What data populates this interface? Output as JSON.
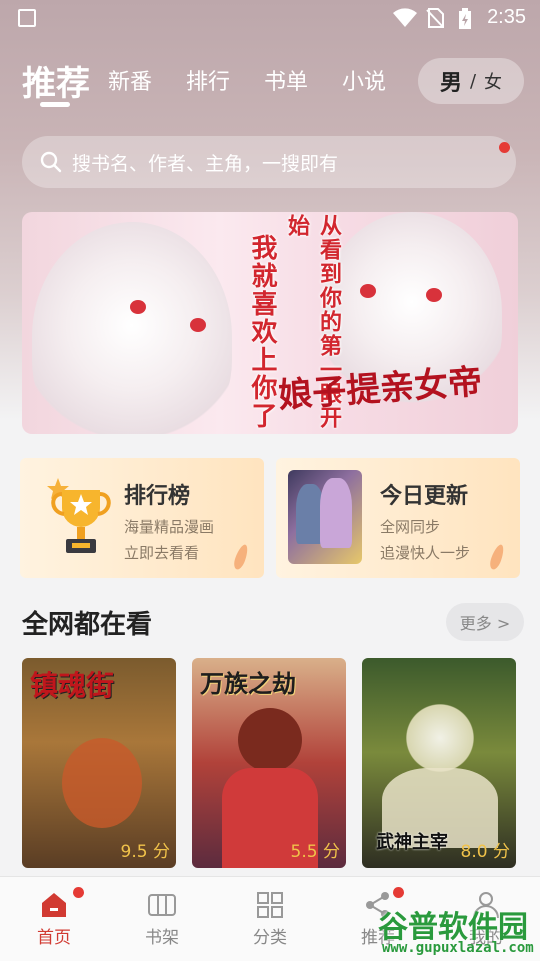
{
  "status_bar": {
    "time": "2:35",
    "icons": [
      "photo-icon",
      "wifi-icon",
      "no-sim-icon",
      "battery-charging-icon"
    ]
  },
  "top_tabs": [
    {
      "label": "推荐",
      "active": true
    },
    {
      "label": "新番",
      "active": false
    },
    {
      "label": "排行",
      "active": false
    },
    {
      "label": "书单",
      "active": false
    },
    {
      "label": "小说",
      "active": false
    }
  ],
  "gender_toggle": {
    "male": "男",
    "sep": "/",
    "female": "女"
  },
  "search": {
    "placeholder": "搜书名、作者、主角，一搜即有"
  },
  "banner": {
    "line1": "我就喜欢上你了",
    "line2": "从看到你的第一眼开始",
    "art_title": "娘子提亲女帝"
  },
  "cards": [
    {
      "title": "排行榜",
      "line1": "海量精品漫画",
      "line2": "立即去看看",
      "icon": "trophy-icon"
    },
    {
      "title": "今日更新",
      "line1": "全网同步",
      "line2": "追漫快人一步",
      "icon": "comic-thumb"
    }
  ],
  "section": {
    "title": "全网都在看",
    "more": "更多 >"
  },
  "comics": [
    {
      "title_art": "镇魂街",
      "score": "9.5 分"
    },
    {
      "title_art": "万族之劫",
      "score": "5.5 分"
    },
    {
      "title_art": "武神主宰",
      "score": "8.0 分"
    }
  ],
  "bottom_nav": [
    {
      "label": "首页",
      "icon": "home-icon",
      "active": true
    },
    {
      "label": "书架",
      "icon": "bookshelf-icon",
      "active": false
    },
    {
      "label": "分类",
      "icon": "grid-icon",
      "active": false
    },
    {
      "label": "推荐",
      "icon": "share-icon",
      "active": false
    },
    {
      "label": "我的",
      "icon": "user-icon",
      "active": false
    }
  ],
  "watermark": {
    "title": "谷普软件园",
    "url": "www.gupuxlazal.com"
  },
  "colors": {
    "accent": "#d13a32",
    "badge": "#e53b35",
    "score": "#f0c24a"
  }
}
